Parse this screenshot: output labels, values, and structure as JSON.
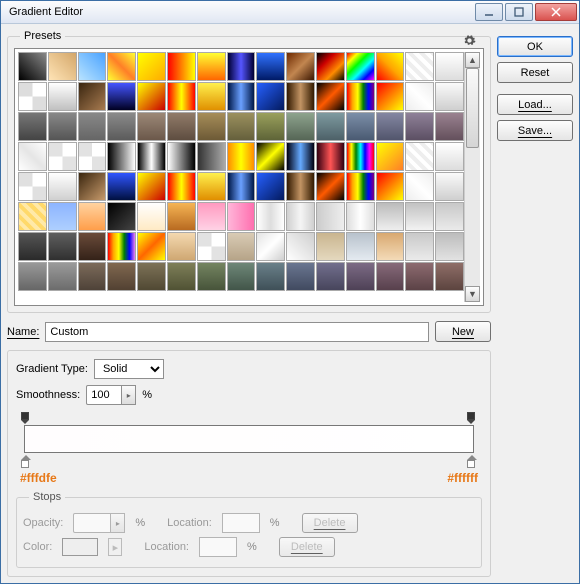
{
  "window": {
    "title": "Gradient Editor"
  },
  "buttons": {
    "ok": "OK",
    "reset": "Reset",
    "load": "Load...",
    "save": "Save...",
    "new": "New"
  },
  "presets": {
    "legend": "Presets"
  },
  "name": {
    "label": "Name:",
    "value": "Custom"
  },
  "type": {
    "label": "Gradient Type:",
    "value": "Solid"
  },
  "smooth": {
    "label": "Smoothness:",
    "value": "100",
    "suffix": "%"
  },
  "hex": {
    "left": "#fffdfe",
    "right": "#ffffff"
  },
  "stops": {
    "legend": "Stops",
    "opacity_label": "Opacity:",
    "color_label": "Color:",
    "location_label": "Location:",
    "delete": "Delete",
    "pct": "%"
  },
  "swatches": [
    "linear-gradient(45deg,#000,#888)",
    "linear-gradient(45deg,#ffe4b6,#d4a76a)",
    "linear-gradient(45deg,#b8e3ff,#4aa3ff)",
    "linear-gradient(45deg,#ff3,#ff7f27,#ff3)",
    "linear-gradient(135deg,#ff0,#fa0)",
    "linear-gradient(90deg,red,yellow)",
    "linear-gradient(#ff3,#f60)",
    "linear-gradient(90deg,#003,#55f,#003)",
    "linear-gradient(#3072ff,#001a66)",
    "linear-gradient(135deg,#6e2a00,#c28650,#3b1600)",
    "linear-gradient(135deg,#000,#c00,#ff8c00,#000)",
    "linear-gradient(135deg,red,yellow,lime,cyan,blue,magenta)",
    "linear-gradient(45deg,red,orange,yellow)",
    "repeating-linear-gradient(45deg,#fff 0 4px,#eee 4px 8px)",
    "linear-gradient(#fff,#ddd)",
    "repeating-conic-gradient(#fff 0 25%,#ddd 0 50%)",
    "linear-gradient(#fff,#c0c0c0)",
    "linear-gradient(135deg,#3a2610,#a87b50)",
    "linear-gradient(#45f,#002)",
    "linear-gradient(135deg,#ff0,#c90000)",
    "linear-gradient(90deg,red,#ff0,red)",
    "linear-gradient(#fff04d,#e09000)",
    "linear-gradient(90deg,#001848,#6aa0ff,#001848)",
    "linear-gradient(135deg,#2660ff,#031a5e)",
    "linear-gradient(90deg,#331a00,#c29464,#331a00)",
    "linear-gradient(135deg,#000,#ff5a00,#000)",
    "linear-gradient(90deg,red,orange,yellow,green,blue,purple)",
    "linear-gradient(135deg,red,#ff0)",
    "linear-gradient(45deg,#eee,#fff,#eee)",
    "linear-gradient(#fafafa,#cfcfcf)",
    "linear-gradient(#777,#444)",
    "linear-gradient(#888,#555)",
    "linear-gradient(#888,#666)",
    "linear-gradient(#8a8a8a,#5b5b5b)",
    "linear-gradient(#9c8877,#6b584a)",
    "linear-gradient(#917b69,#5e4d40)",
    "linear-gradient(#a68d59,#6d5a36)",
    "linear-gradient(#9b905e,#65603c)",
    "linear-gradient(#9aa05c,#5e6438)",
    "linear-gradient(#8da38d,#566656)",
    "linear-gradient(#7e9aa0,#4d6168)",
    "linear-gradient(#7c8fa8,#4a5a72)",
    "linear-gradient(#8487a2,#52556c)",
    "linear-gradient(#8f8198,#5c4f63)",
    "linear-gradient(#9a8290,#64505c)",
    "linear-gradient(45deg,#fff,#e5e5e5,#fff)",
    "repeating-conic-gradient(#fff 0 25%,#e2e2e2 0 50%)",
    "repeating-conic-gradient(#fff 0 25%,#e2e2e2 0 50%)",
    "linear-gradient(90deg,#000,#fff)",
    "linear-gradient(90deg,#000,#fff,#000)",
    "linear-gradient(90deg,#fff,#000)",
    "linear-gradient(90deg,#333,#aaa)",
    "linear-gradient(90deg,#ff8c00,#ff0,#ff8c00)",
    "linear-gradient(135deg,#000,#ff0,#000)",
    "linear-gradient(90deg,#001,#6af,#001)",
    "linear-gradient(90deg,#301,#f55,#301)",
    "linear-gradient(90deg,red,yellow,green,cyan,blue,magenta,red)",
    "linear-gradient(135deg,#ff0,#ff7f27)",
    "repeating-linear-gradient(45deg,#fff 0 4px,#eee 4px 8px)",
    "linear-gradient(#fff,#ddd)",
    "repeating-conic-gradient(#fff 0 25%,#e0e0e0 0 50%)",
    "linear-gradient(#fff,#d0d0d0)",
    "linear-gradient(135deg,#3a260f,#c79a6b)",
    "linear-gradient(#3055ff,#001040)",
    "linear-gradient(135deg,#ff0,#c00)",
    "linear-gradient(90deg,red,#ff0,red)",
    "linear-gradient(#fff04d,#e08e00)",
    "linear-gradient(90deg,#001848,#6aa0ff,#001848)",
    "linear-gradient(135deg,#2660ff,#031a5e)",
    "linear-gradient(90deg,#331a00,#c29464,#331a00)",
    "linear-gradient(135deg,#000,#ff5a00,#000)",
    "linear-gradient(90deg,red,orange,yellow,green,blue,purple)",
    "linear-gradient(135deg,red,#ff0)",
    "linear-gradient(45deg,#eee,#fff,#eee)",
    "linear-gradient(#fafafa,#cfcfcf)",
    "repeating-linear-gradient(45deg,#ffd96a 0 4px,#ffe9a8 4px 8px)",
    "linear-gradient(#8db4ff,#aecfff)",
    "linear-gradient(#ffd3a0,#ff9e4a)",
    "linear-gradient(135deg,#000,#444)",
    "linear-gradient(#fff,#ffeac4)",
    "linear-gradient(#f5b455,#b86a20)",
    "linear-gradient(#ff9ac0,#ffd2e5)",
    "linear-gradient(90deg,#ffb6d9,#ff6faf)",
    "linear-gradient(90deg,#fff,#ddd,#fff)",
    "linear-gradient(90deg,#d0d0d0,#f5f5f5,#d0d0d0)",
    "linear-gradient(90deg,#ccc,#eee)",
    "linear-gradient(90deg,#dedede,#fff,#dedede)",
    "linear-gradient(#bbb,#eee)",
    "linear-gradient(#c2c2c2,#f2f2f2)",
    "linear-gradient(#c8c8c8,#eaeaea)",
    "linear-gradient(#555,#2a2a2a)",
    "linear-gradient(#5f5f5f,#303030)",
    "linear-gradient(#6a4b3a,#342218)",
    "linear-gradient(90deg,red,orange,yellow,green,blue,violet)",
    "linear-gradient(135deg,#ff0,#f60,#ff0)",
    "linear-gradient(#f4d9b0,#cfa772)",
    "repeating-conic-gradient(#fff 0 25%,#e2e2e2 0 50%)",
    "linear-gradient(#d9cbb5,#b6a488)",
    "linear-gradient(135deg,#e3e3e3,#fff,#cfcfcf)",
    "linear-gradient(45deg,#fff,#cfcfcf)",
    "linear-gradient(#c9b58f,#e4d8be)",
    "linear-gradient(#b8c2cc,#e4eaf0)",
    "linear-gradient(#d8a870,#f3dbb8)",
    "linear-gradient(#c9c9c9,#eaeaea)",
    "linear-gradient(#bcbcbc,#e2e2e2)",
    "linear-gradient(#999,#666)",
    "linear-gradient(#9a9a9a,#6c6c6c)",
    "linear-gradient(#7c6b5a,#4e4238)",
    "linear-gradient(#806850,#524132)",
    "linear-gradient(#7d7257,#504833)",
    "linear-gradient(#7e7f59,#505234)",
    "linear-gradient(#748461,#47543a)",
    "linear-gradient(#6e8778,#425549)",
    "linear-gradient(#6a8089,#3f5058)",
    "linear-gradient(#6a7690,#414a60)",
    "linear-gradient(#726f8d,#47455c)",
    "linear-gradient(#7c6b85,#4e4156)",
    "linear-gradient(#876a7a,#57404c)",
    "linear-gradient(#8d6b70,#5b4246)",
    "linear-gradient(#8f6e68,#5c443f)"
  ]
}
